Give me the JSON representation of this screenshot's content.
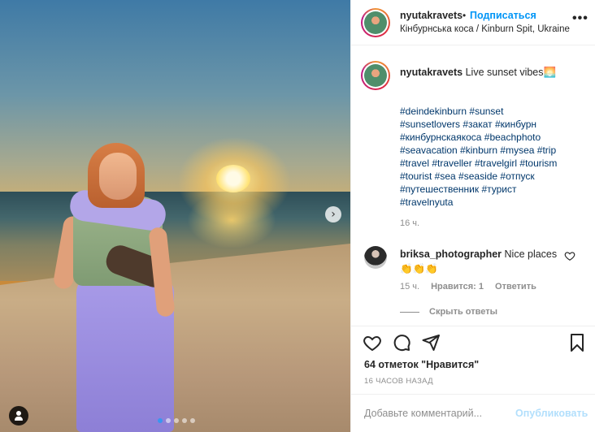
{
  "post": {
    "username": "nyutakravets",
    "follow_label": "Подписаться",
    "separator": "•",
    "location": "Кінбурнська коса / Kinburn Spit, Ukraine",
    "more_label": "•••"
  },
  "caption": {
    "username": "nyutakravets",
    "text": "Live sunset vibes🌅",
    "hashtags": [
      "#deindekinburn #sunset",
      "#sunsetlovers #закат #кинбурн",
      "#кинбурнскаякоса #beachphoto",
      "#seavacation #kinburn #mysea #trip",
      "#travel #traveller #travelgirl #tourism",
      "#tourist #sea #seaside #отпуск",
      "#путешественник #турист",
      "#travelnyuta"
    ],
    "time": "16 ч."
  },
  "reply": {
    "username": "briksa_photographer",
    "text": "Nice places",
    "emoji": "👏👏👏",
    "time": "15 ч.",
    "likes_label": "Нравится: 1",
    "reply_label": "Ответить",
    "hide_label": "Скрыть ответы"
  },
  "footer": {
    "likes": "64 отметок \"Нравится\"",
    "ago": "16 ЧАСОВ НАЗАД",
    "comment_placeholder": "Добавьте комментарий...",
    "publish_label": "Опубликовать"
  },
  "carousel": {
    "slides": 5,
    "active_index": 0
  },
  "colors": {
    "accent": "#0095f6",
    "muted": "#8e8e8e",
    "hashtag": "#00376b"
  }
}
